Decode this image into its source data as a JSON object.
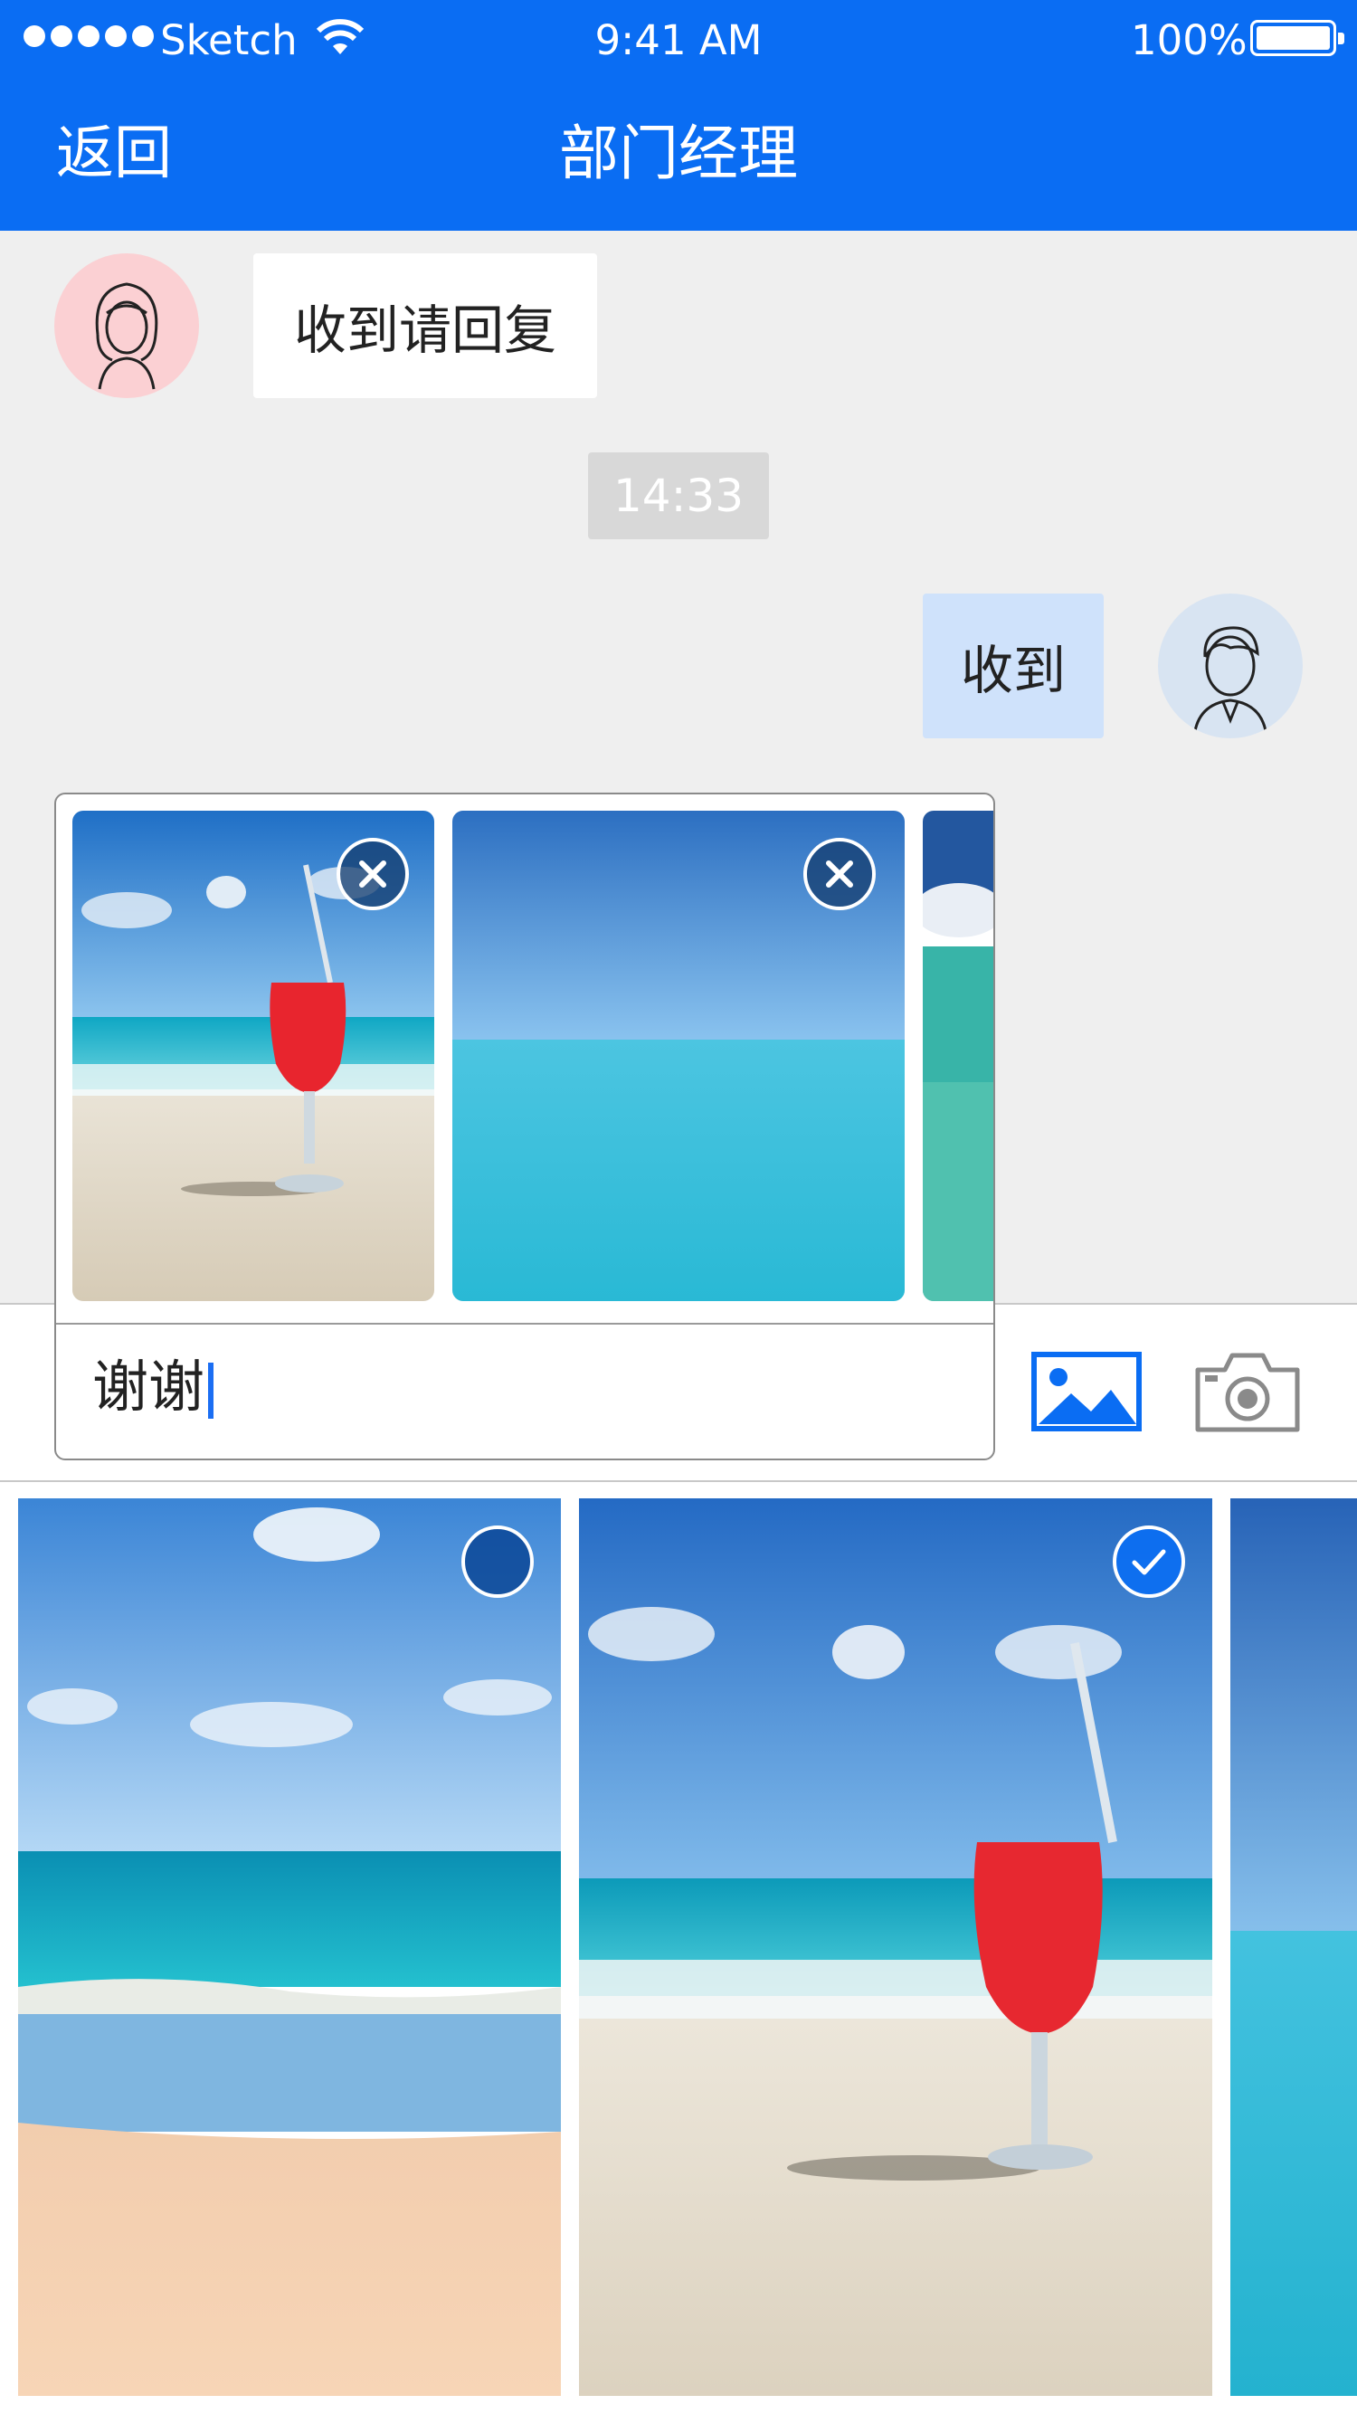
{
  "status_bar": {
    "carrier": "Sketch",
    "time": "9:41 AM",
    "battery": "100%"
  },
  "nav": {
    "back_label": "返回",
    "title": "部门经理"
  },
  "messages": {
    "incoming": "收到请回复",
    "timestamp": "14:33",
    "outgoing": "收到"
  },
  "composer": {
    "text": "谢谢",
    "attachments": [
      "beach-drink-photo",
      "ocean-horizon-photo",
      "ocean-photo"
    ]
  },
  "photo_grid": {
    "items": [
      {
        "name": "beach-waves-photo",
        "selected": false
      },
      {
        "name": "beach-drink-photo",
        "selected": true
      },
      {
        "name": "ocean-photo",
        "selected": false
      }
    ]
  },
  "colors": {
    "primary": "#0A6DF3",
    "outgoing_bubble": "#cfe2fb",
    "background": "#efefef"
  }
}
